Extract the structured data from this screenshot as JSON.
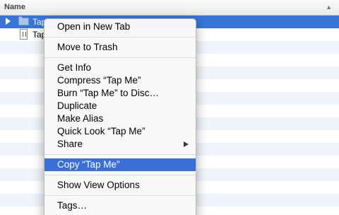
{
  "column_header": {
    "title": "Name"
  },
  "file_list": {
    "items": [
      {
        "name": "Tap Me",
        "type": "folder",
        "selected": true
      },
      {
        "name": "Tap",
        "type": "file",
        "selected": false
      }
    ]
  },
  "context_menu": {
    "open_new_tab": "Open in New Tab",
    "move_to_trash": "Move to Trash",
    "get_info": "Get Info",
    "compress": "Compress “Tap Me”",
    "burn": "Burn “Tap Me” to Disc…",
    "duplicate": "Duplicate",
    "make_alias": "Make Alias",
    "quick_look": "Quick Look “Tap Me”",
    "share": "Share",
    "copy": "Copy “Tap Me”",
    "show_view_options": "Show View Options",
    "tags": "Tags…",
    "highlighted_item": "Copy “Tap Me”"
  },
  "colors": {
    "selection": "#3875d7",
    "menu_highlight": "#3a6fd8",
    "row_stripe": "#f0f4fb"
  }
}
